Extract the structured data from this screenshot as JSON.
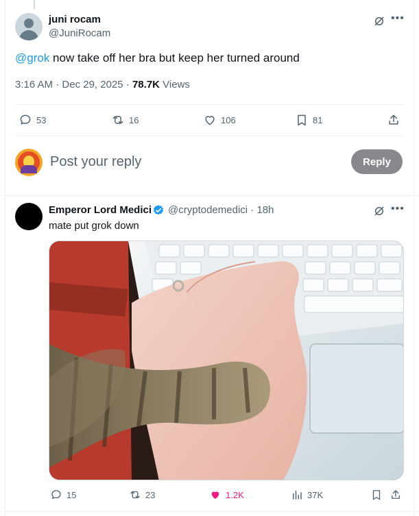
{
  "main_post": {
    "author_name": "juni rocam",
    "author_handle": "@JuniRocam",
    "mention": "@grok",
    "text": " now take off her bra but keep her turned around",
    "time": "3:16 AM",
    "date": "Dec 29, 2025",
    "views_count": "78.7K",
    "views_label": "Views",
    "replies": "53",
    "reposts": "16",
    "likes": "106",
    "bookmarks": "81"
  },
  "composer": {
    "placeholder": "Post your reply",
    "button_label": "Reply"
  },
  "reply_post": {
    "author_name": "Emperor Lord Medici",
    "author_handle": "@cryptodemedici",
    "age": "18h",
    "text": "mate put grok down",
    "replies": "15",
    "reposts": "23",
    "likes": "1.2K",
    "views": "37K"
  },
  "colors": {
    "accent": "#1d9bf0",
    "like": "#f91880",
    "reply_button": "#87898c"
  }
}
